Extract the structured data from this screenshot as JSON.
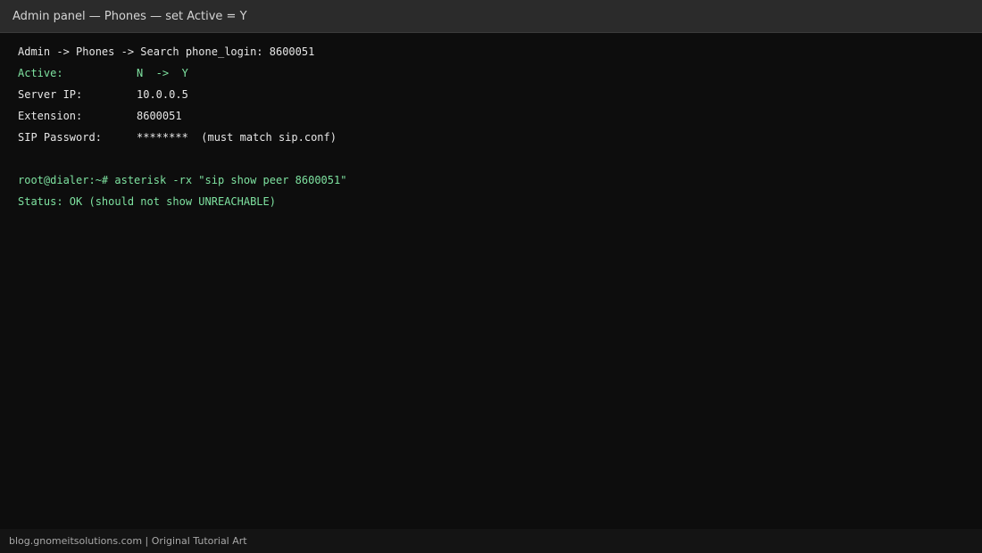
{
  "window": {
    "title": "Admin panel — Phones — set Active = Y"
  },
  "terminal": {
    "breadcrumb": "Admin -> Phones -> Search phone_login: 8600051",
    "fields": [
      {
        "label": "Active:",
        "value": "N  ->  Y"
      },
      {
        "label": "Server IP:",
        "value": "10.0.0.5"
      },
      {
        "label": "Extension:",
        "value": "8600051"
      },
      {
        "label": "SIP Password:",
        "value": "********  (must match sip.conf)"
      }
    ],
    "command": "root@dialer:~# asterisk -rx \"sip show peer 8600051\"",
    "status": "Status: OK (should not show UNREACHABLE)"
  },
  "footer": {
    "text": "blog.gnomeitsolutions.com | Original Tutorial Art"
  },
  "colors": {
    "background": "#0d0d0d",
    "titlebar": "#2b2b2b",
    "text": "#e6e6e6",
    "accent_green": "#7ee2a0"
  }
}
